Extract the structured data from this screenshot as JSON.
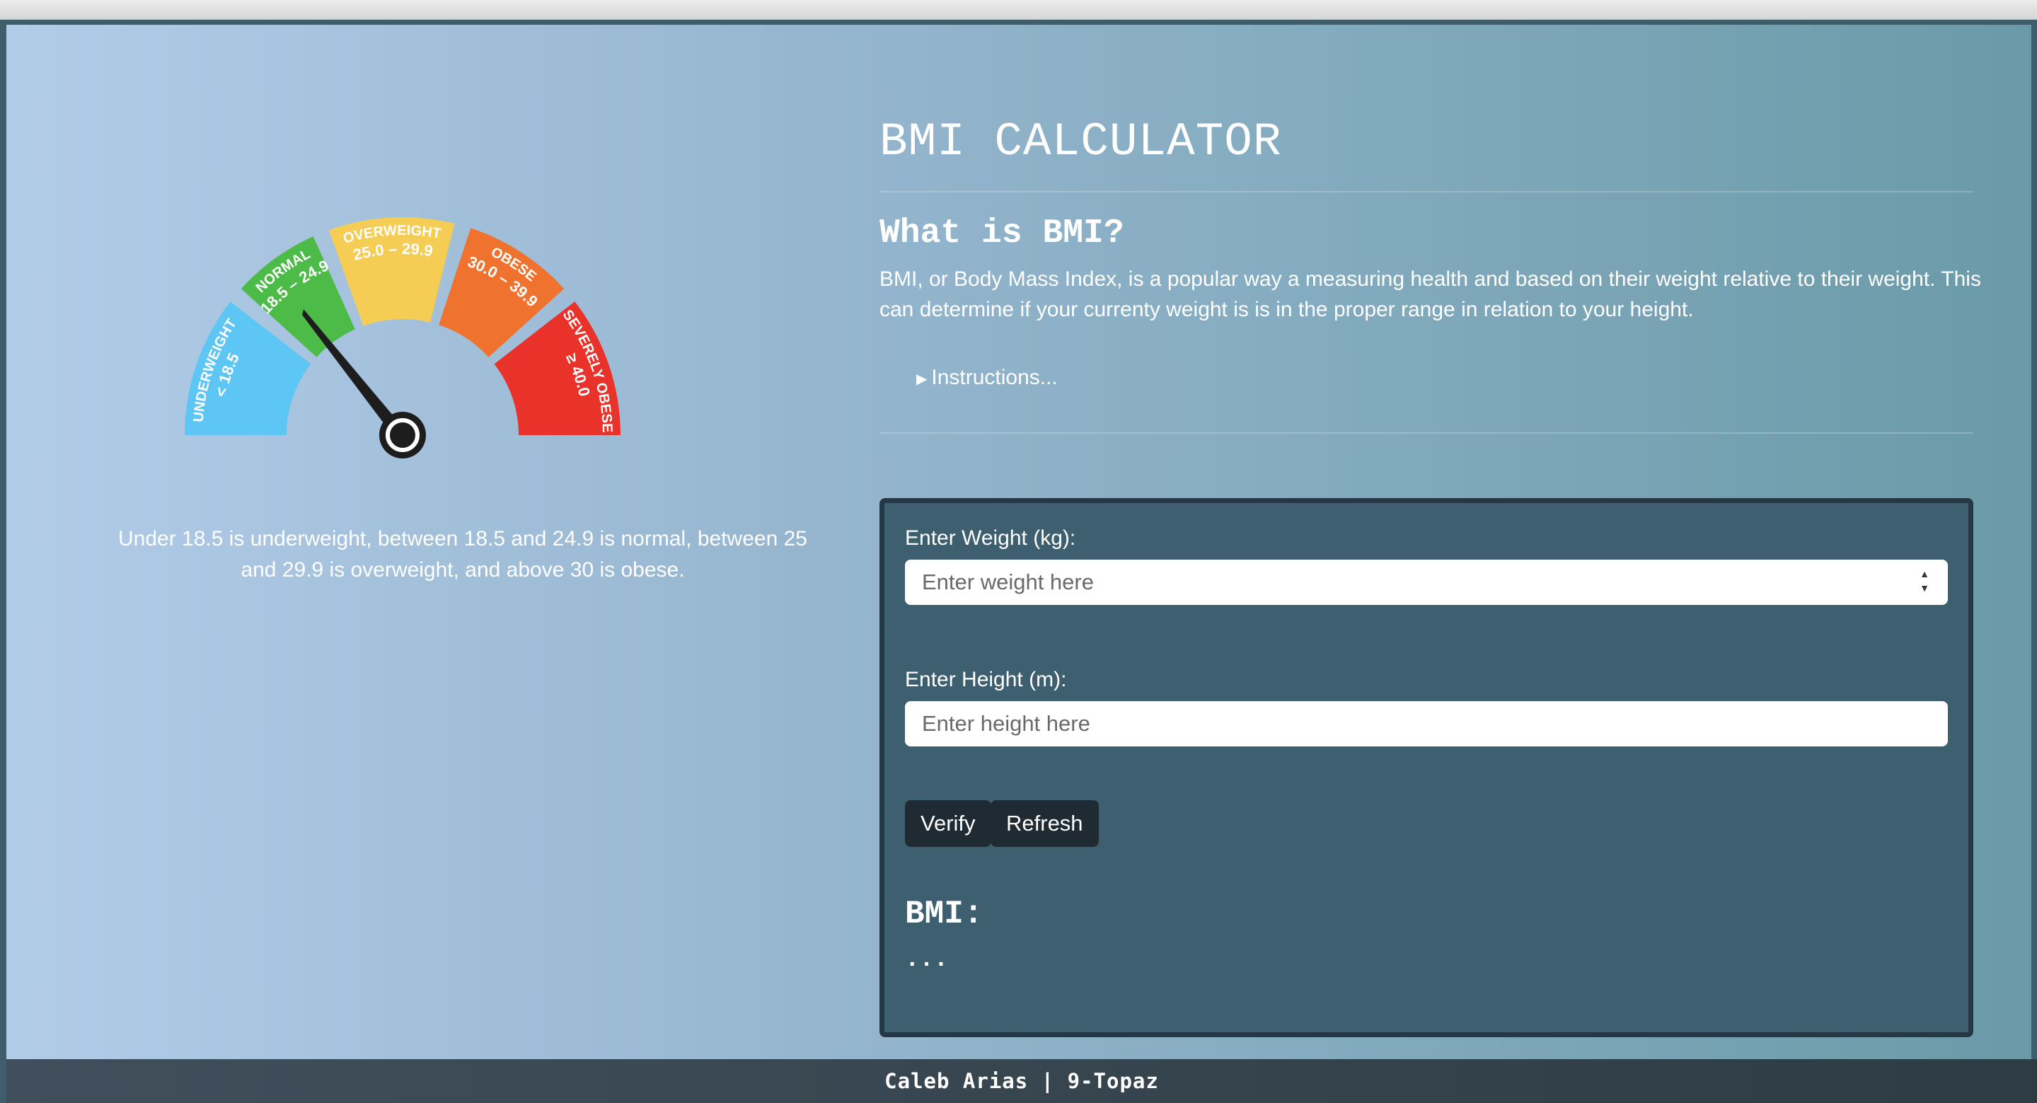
{
  "gauge": {
    "segments": [
      {
        "name": "UNDERWEIGHT",
        "range": "< 18.5",
        "color": "#5ec6f4"
      },
      {
        "name": "NORMAL",
        "range": "18.5 – 24.9",
        "color": "#4cbb47"
      },
      {
        "name": "OVERWEIGHT",
        "range": "25.0 – 29.9",
        "color": "#f5cd54"
      },
      {
        "name": "OBESE",
        "range": "30.0 – 39.9",
        "color": "#ef732e"
      },
      {
        "name": "SEVERELY OBESE",
        "range": "≥ 40.0",
        "color": "#e8322a"
      }
    ],
    "needle_color": "#1d1d1d",
    "caption": "Under 18.5 is underweight, between 18.5 and 24.9 is normal, between 25 and 29.9 is overweight, and above 30 is obese."
  },
  "header": {
    "title": "BMI CALCULATOR",
    "subtitle": "What is BMI?",
    "description": "BMI, or Body Mass Index, is a popular way a measuring health and based on their weight relative to their weight. This can determine if your currenty weight is is in the proper range in relation to your height.",
    "instructions_label": "Instructions..."
  },
  "form": {
    "weight_label": "Enter Weight (kg):",
    "weight_placeholder": "Enter weight here",
    "height_label": "Enter Height (m):",
    "height_placeholder": "Enter height here",
    "verify_label": "Verify",
    "refresh_label": "Refresh",
    "bmi_title": "BMI:",
    "bmi_value": "..."
  },
  "footer": {
    "text": "Caleb Arias | 9-Topaz"
  },
  "colors": {
    "card_bg": "#3d5f70",
    "button_bg": "#1f2a32",
    "footer_bg": "#36444f"
  }
}
